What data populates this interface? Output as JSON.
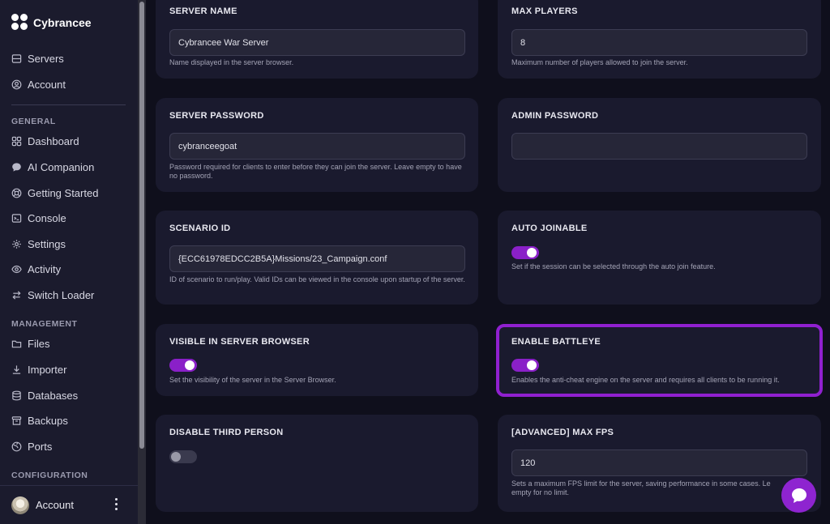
{
  "app": {
    "name": "Cybrancee"
  },
  "sidebar": {
    "top_items": [
      {
        "label": "Servers",
        "icon": "server-icon"
      },
      {
        "label": "Account",
        "icon": "user-circle-icon"
      }
    ],
    "sections": [
      {
        "label": "GENERAL",
        "items": [
          {
            "label": "Dashboard",
            "icon": "grid-icon"
          },
          {
            "label": "AI Companion",
            "icon": "chat-bubble-icon"
          },
          {
            "label": "Getting Started",
            "icon": "lifebuoy-icon"
          },
          {
            "label": "Console",
            "icon": "terminal-icon"
          },
          {
            "label": "Settings",
            "icon": "gear-icon"
          },
          {
            "label": "Activity",
            "icon": "eye-icon"
          },
          {
            "label": "Switch Loader",
            "icon": "swap-icon"
          }
        ]
      },
      {
        "label": "MANAGEMENT",
        "items": [
          {
            "label": "Files",
            "icon": "folder-icon"
          },
          {
            "label": "Importer",
            "icon": "download-icon"
          },
          {
            "label": "Databases",
            "icon": "database-icon"
          },
          {
            "label": "Backups",
            "icon": "archive-icon"
          },
          {
            "label": "Ports",
            "icon": "globe-icon"
          }
        ]
      },
      {
        "label": "CONFIGURATION",
        "items": []
      }
    ],
    "account_bar": {
      "label": "Account"
    }
  },
  "settings": {
    "server_name": {
      "title": "SERVER NAME",
      "value": "Cybrancee War Server",
      "help": "Name displayed in the server browser."
    },
    "max_players": {
      "title": "MAX PLAYERS",
      "value": "8",
      "help": "Maximum number of players allowed to join the server."
    },
    "server_password": {
      "title": "SERVER PASSWORD",
      "value": "cybranceegoat",
      "help": "Password required for clients to enter before they can join the server. Leave empty to have no password."
    },
    "admin_password": {
      "title": "ADMIN PASSWORD",
      "value": ""
    },
    "scenario_id": {
      "title": "SCENARIO ID",
      "value": "{ECC61978EDCC2B5A}Missions/23_Campaign.conf",
      "help": "ID of scenario to run/play. Valid IDs can be viewed in the console upon startup of the server."
    },
    "auto_joinable": {
      "title": "AUTO JOINABLE",
      "enabled": true,
      "help": "Set if the session can be selected through the auto join feature."
    },
    "visible_in_browser": {
      "title": "VISIBLE IN SERVER BROWSER",
      "enabled": true,
      "help": "Set the visibility of the server in the Server Browser."
    },
    "enable_battleye": {
      "title": "ENABLE BATTLEYE",
      "enabled": true,
      "help": "Enables the anti-cheat engine on the server and requires all clients to be running it."
    },
    "disable_third_person": {
      "title": "DISABLE THIRD PERSON",
      "enabled": false
    },
    "max_fps": {
      "title": "[ADVANCED] MAX FPS",
      "value": "120",
      "help_line1": "Sets a maximum FPS limit for the server, saving performance in some cases. Le",
      "help_line2": "empty for no limit."
    }
  },
  "colors": {
    "accent": "#8a20c8",
    "highlight_border": "#9020d0",
    "card_bg": "#1a1a2e",
    "page_bg": "#0f0f1c",
    "sidebar_bg": "#1b1b2d"
  }
}
